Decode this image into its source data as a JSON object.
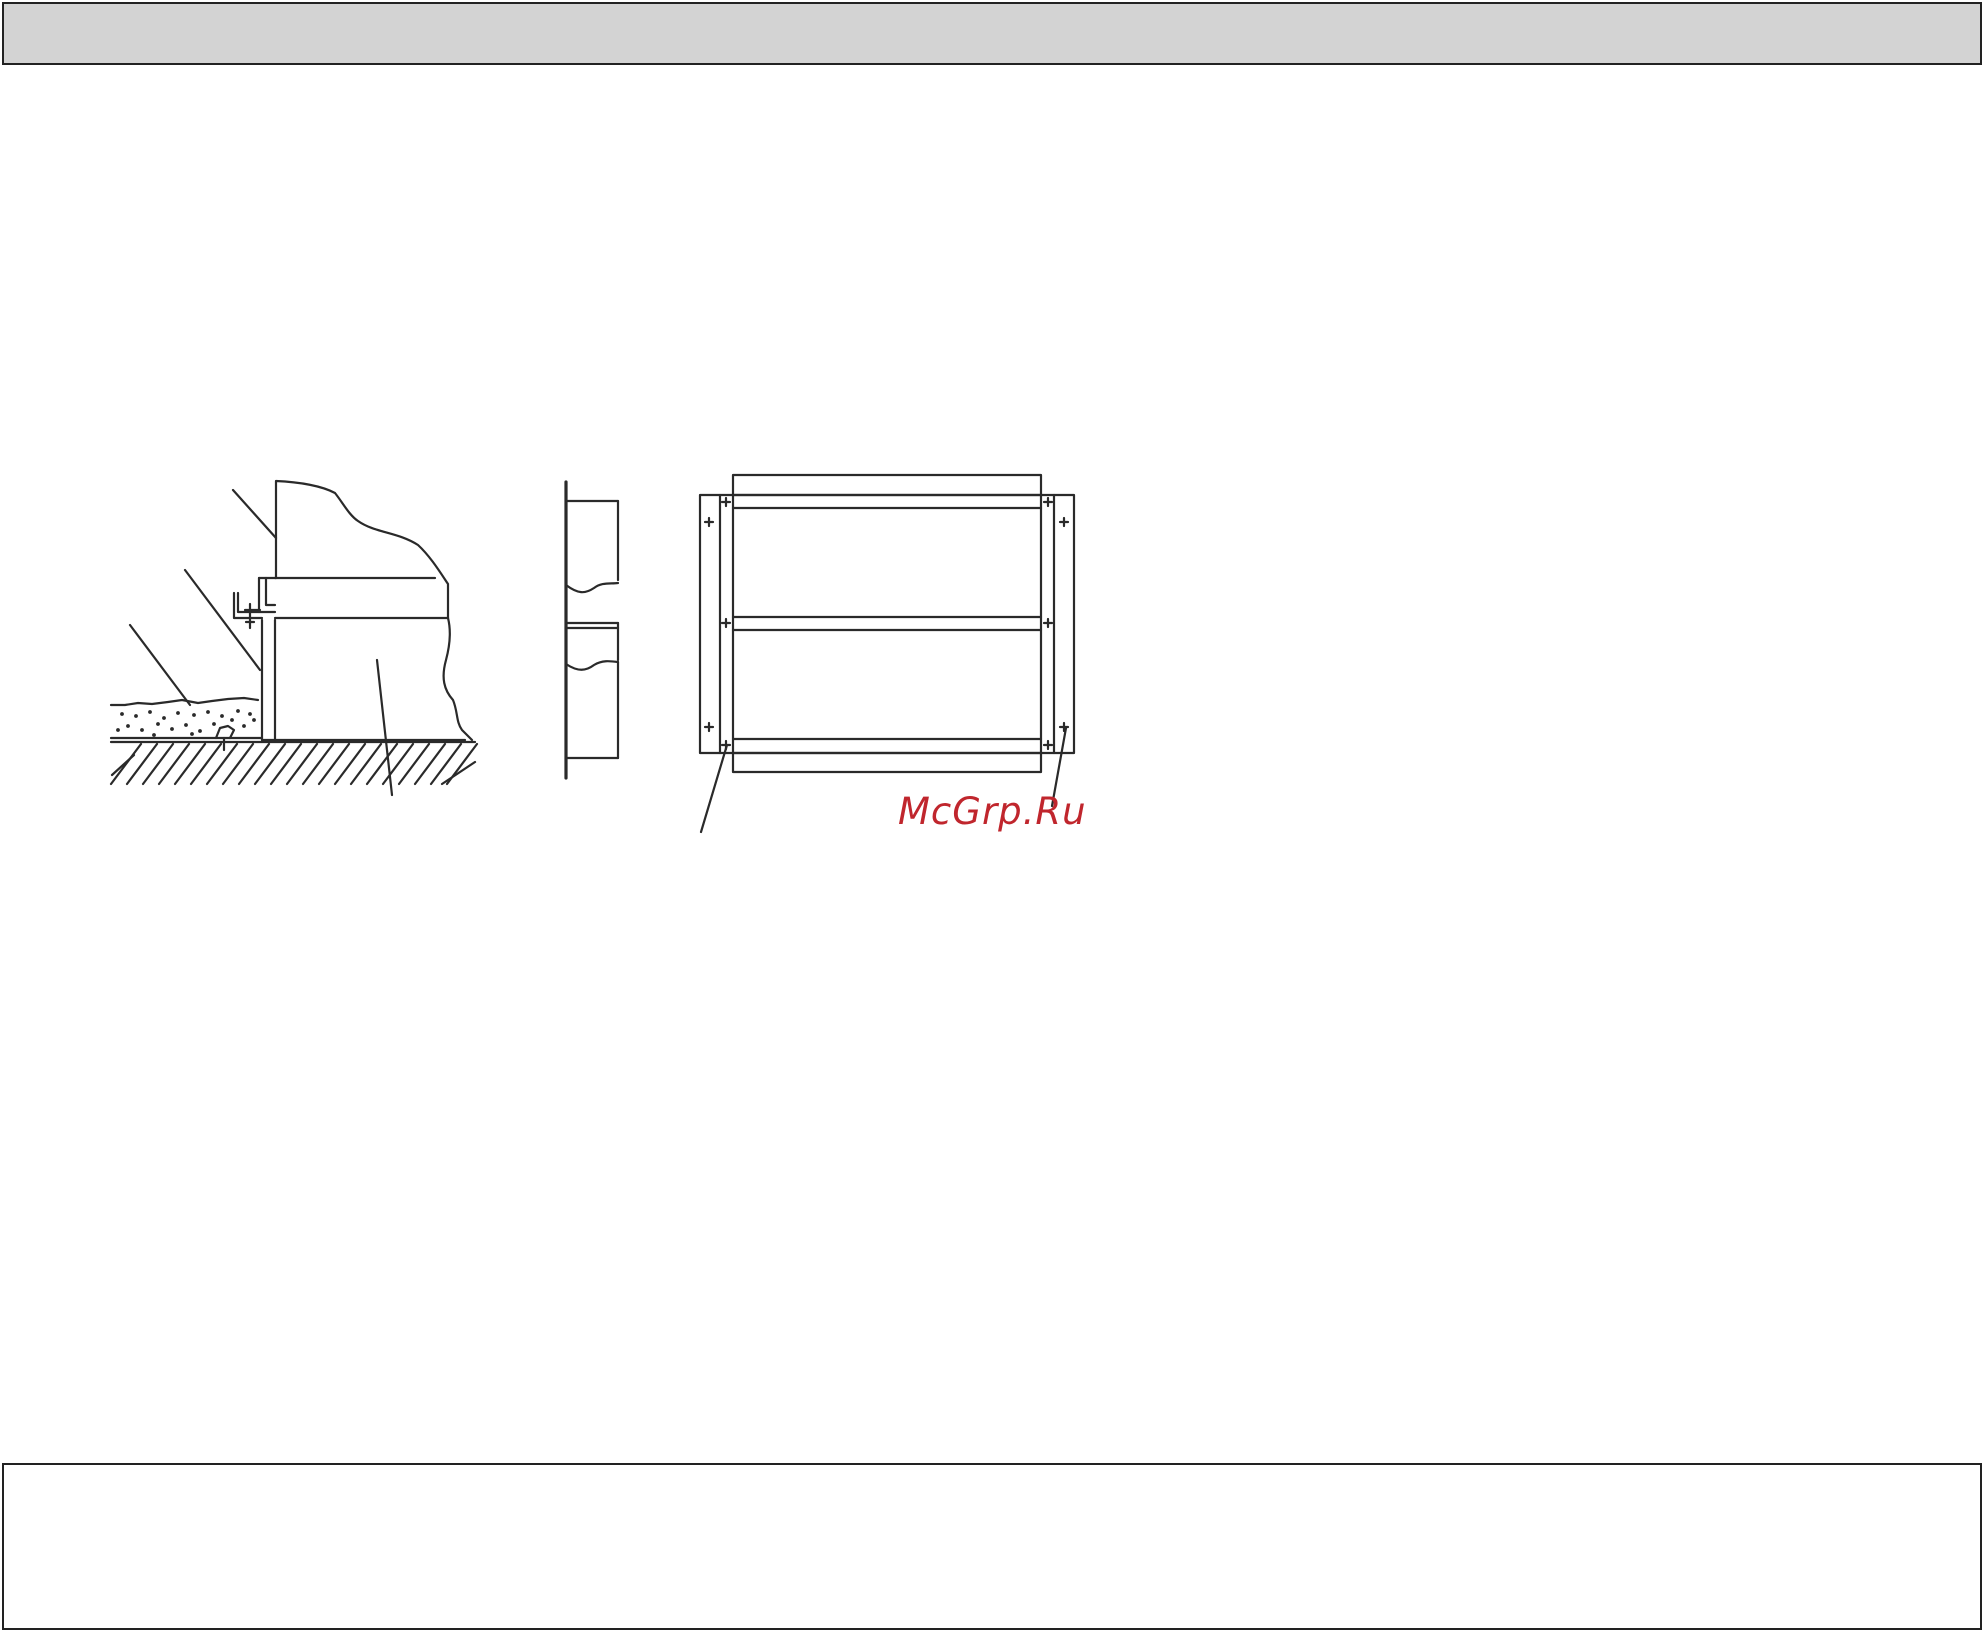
{
  "watermark": {
    "text": "McGrp.Ru",
    "color": "#c0262d"
  },
  "colors": {
    "header_bar": "#d3d3d3",
    "line": "#2a2a2a",
    "background": "#ffffff"
  },
  "figures": [
    {
      "name": "section-view-drawing",
      "icon": "duct-section-cutaway"
    },
    {
      "name": "side-view-drawing",
      "icon": "panel-side-profile"
    },
    {
      "name": "front-view-drawing",
      "icon": "flanged-panel-front"
    }
  ]
}
